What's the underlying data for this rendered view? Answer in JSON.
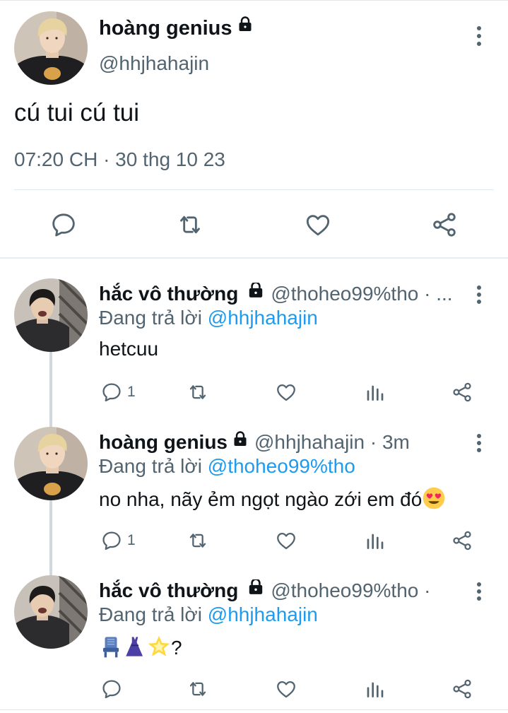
{
  "main_tweet": {
    "author_name": "hoàng genius",
    "author_handle": "@hhjhahajin",
    "text": "cú tui cú tui",
    "timestamp": "07:20 CH · 30 thg 10 23",
    "icons": {
      "reply": "reply-icon",
      "retweet": "retweet-icon",
      "like": "heart-icon",
      "share": "share-icon"
    }
  },
  "replies": [
    {
      "author_name": "hắc vô thường",
      "author_handle": "@thoheo99%tho · ...",
      "replying_prefix": "Đang trả lời",
      "replying_to": "@hhjhahajin",
      "text": "hetcuu",
      "reply_count": "1"
    },
    {
      "author_name": "hoàng genius",
      "author_handle": "@hhjhahajin · 3m",
      "replying_prefix": "Đang trả lời",
      "replying_to": "@thoheo99%tho",
      "text": "no nha, nãy ẻm ngọt ngào zới em đó",
      "emoji": "heart-eyes-emoji",
      "reply_count": "1"
    },
    {
      "author_name": "hắc vô thường",
      "author_handle": "@thoheo99%tho ·",
      "replying_prefix": "Đang trả lời",
      "replying_to": "@hhjhahajin",
      "text": "?",
      "emojis": [
        "seat-emoji",
        "dress-emoji",
        "glowing-star-emoji"
      ],
      "reply_count": ""
    }
  ],
  "colors": {
    "secondary_text": "#536471",
    "link": "#1d9bf0",
    "thread_line": "#cfd9de"
  }
}
